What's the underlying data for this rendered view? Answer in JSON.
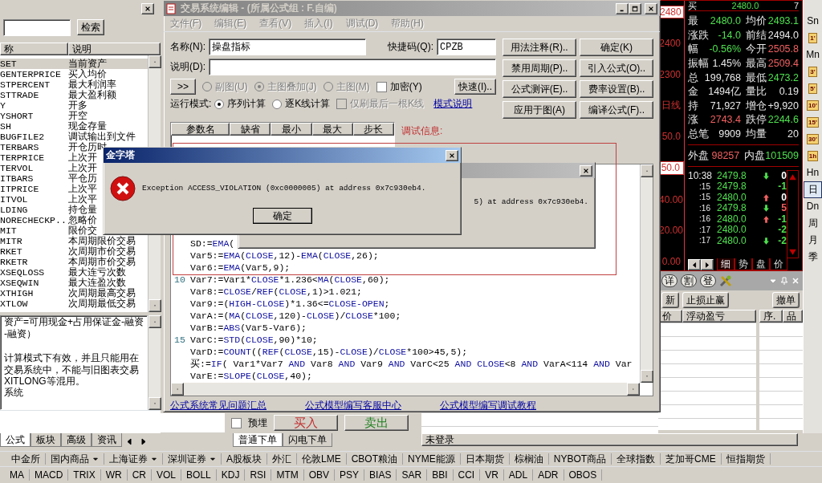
{
  "left_panel": {
    "search_button": "检索",
    "columns": [
      "称",
      "说明"
    ],
    "rows": [
      {
        "name": "SET",
        "desc": "当前资产",
        "selected": true
      },
      {
        "name": "GENTERPRICE",
        "desc": "买入均价",
        "selected": false
      },
      {
        "name": "STPERCENT",
        "desc": "最大利润率",
        "selected": false
      },
      {
        "name": "STTRADE",
        "desc": "最大盈利额",
        "selected": false
      },
      {
        "name": "Y",
        "desc": "开多",
        "selected": false
      },
      {
        "name": "YSHORT",
        "desc": "开空",
        "selected": false
      },
      {
        "name": "SH",
        "desc": "现金存量",
        "selected": false
      },
      {
        "name": "BUGFILE2",
        "desc": "调试输出到文件",
        "selected": false
      },
      {
        "name": "TERBARS",
        "desc": "开仓历时",
        "selected": false
      },
      {
        "name": "TERPRICE",
        "desc": "上次开",
        "selected": false
      },
      {
        "name": "TERVOL",
        "desc": "上次开",
        "selected": false
      },
      {
        "name": "ITBARS",
        "desc": "平仓历",
        "selected": false
      },
      {
        "name": "ITPRICE",
        "desc": "上次平",
        "selected": false
      },
      {
        "name": "ITVOL",
        "desc": "上次平",
        "selected": false
      },
      {
        "name": "LDING",
        "desc": "持仓量",
        "selected": false
      },
      {
        "name": "NORECHECKP...",
        "desc": "忽略价",
        "selected": false
      },
      {
        "name": "MIT",
        "desc": "限价交",
        "selected": false
      },
      {
        "name": "MITR",
        "desc": "本周期限价交易",
        "selected": false
      },
      {
        "name": "RKET",
        "desc": "次周期市价交易",
        "selected": false
      },
      {
        "name": "RKETR",
        "desc": "本周期市价交易",
        "selected": false
      },
      {
        "name": "XSEQLOSS",
        "desc": "最大连亏次数",
        "selected": false
      },
      {
        "name": "XSEQWIN",
        "desc": "最大连盈次数",
        "selected": false
      },
      {
        "name": "XTHIGH",
        "desc": "次周期最高交易",
        "selected": false
      },
      {
        "name": "XTLOW",
        "desc": "次周期最低交易",
        "selected": false
      }
    ],
    "description": [
      [
        "资产=可用现金+占用保证金-融资",
        "-融资）"
      ],
      [
        "计算模式下有效，并且只能用在",
        "交易系统中，不能与旧图表交易",
        "XITLONG等混用。",
        "系统"
      ]
    ]
  },
  "editor": {
    "title": "交易系统编辑 - (所属公式组 : F.自编)",
    "menu": [
      {
        "label": "文件(F)",
        "disabled": true
      },
      {
        "label": "编辑(E)",
        "disabled": true
      },
      {
        "label": "查看(V)",
        "disabled": true
      },
      {
        "label": "插入(I)",
        "disabled": true
      },
      {
        "label": "调试(D)",
        "disabled": true
      },
      {
        "label": "帮助(H)",
        "disabled": true
      }
    ],
    "name_field": {
      "label": "名称(N):",
      "value": "操盘指标"
    },
    "shortcut_field": {
      "label": "快捷码(Q):",
      "value": "CPZB"
    },
    "desc_field": {
      "label": "说明(D):"
    },
    "side_buttons": [
      "用法注释(R)..",
      "确定(K)",
      "禁用周期(P)..",
      "引入公式(O)..",
      "公式测评(E)..",
      "费率设置(B)..",
      "应用于图(A)",
      "编译公式(F).."
    ],
    "expand_button": ">>",
    "chart_modes": [
      {
        "label": "副图(U)",
        "selected": false,
        "disabled": true
      },
      {
        "label": "主图叠加(J)",
        "selected": true,
        "disabled": true
      },
      {
        "label": "主图(M)",
        "selected": false,
        "disabled": true
      }
    ],
    "encrypt": {
      "label": "加密(Y)",
      "checked": false
    },
    "quick_button": "快速(I)..",
    "run_mode": {
      "label": "运行模式:",
      "options": [
        {
          "label": "序列计算",
          "selected": true
        },
        {
          "label": "逐K线计算",
          "selected": false
        }
      ],
      "last_bar": {
        "label": "仅刷最后一根K线",
        "checked": false,
        "disabled": true
      },
      "help_link": "模式说明"
    },
    "param_columns": [
      "参数名",
      "缺省",
      "最小",
      "最大",
      "步长"
    ],
    "debug_label": "调试信息:",
    "code_lines": [
      {
        "tokens": [
          {
            "t": "SD:=",
            "kw": false
          },
          {
            "t": "EMA",
            "kw": true
          },
          {
            "t": "(",
            "kw": false
          }
        ]
      },
      {
        "tokens": [
          {
            "t": "Var5:=",
            "kw": false
          },
          {
            "t": "EMA",
            "kw": true
          },
          {
            "t": "(",
            "kw": false
          },
          {
            "t": "CLOSE",
            "kw": true
          },
          {
            "t": ",12)-",
            "kw": false
          },
          {
            "t": "EMA",
            "kw": true
          },
          {
            "t": "(",
            "kw": false
          },
          {
            "t": "CLOSE",
            "kw": true
          },
          {
            "t": ",26);",
            "kw": false
          }
        ]
      },
      {
        "tokens": [
          {
            "t": "Var6:=",
            "kw": false
          },
          {
            "t": "EMA",
            "kw": true
          },
          {
            "t": "(Var5,9);",
            "kw": false
          }
        ]
      },
      {
        "number": "10",
        "tokens": [
          {
            "t": "Var7:=Var1*",
            "kw": false
          },
          {
            "t": "CLOSE",
            "kw": true
          },
          {
            "t": "*1.236<",
            "kw": false
          },
          {
            "t": "MA",
            "kw": true
          },
          {
            "t": "(",
            "kw": false
          },
          {
            "t": "CLOSE",
            "kw": true
          },
          {
            "t": ",60);",
            "kw": false
          }
        ]
      },
      {
        "tokens": [
          {
            "t": "Var8:=",
            "kw": false
          },
          {
            "t": "CLOSE",
            "kw": true
          },
          {
            "t": "/",
            "kw": false
          },
          {
            "t": "REF",
            "kw": true
          },
          {
            "t": "(",
            "kw": false
          },
          {
            "t": "CLOSE",
            "kw": true
          },
          {
            "t": ",1)>1.021;",
            "kw": false
          }
        ]
      },
      {
        "tokens": [
          {
            "t": "Var9:=(",
            "kw": false
          },
          {
            "t": "HIGH-CLOSE",
            "kw": true
          },
          {
            "t": ")*1.36<=",
            "kw": false
          },
          {
            "t": "CLOSE-OPEN",
            "kw": true
          },
          {
            "t": ";",
            "kw": false
          }
        ]
      },
      {
        "tokens": [
          {
            "t": "VarA:=(",
            "kw": false
          },
          {
            "t": "MA",
            "kw": true
          },
          {
            "t": "(",
            "kw": false
          },
          {
            "t": "CLOSE",
            "kw": true
          },
          {
            "t": ",120)-",
            "kw": false
          },
          {
            "t": "CLOSE",
            "kw": true
          },
          {
            "t": ")/",
            "kw": false
          },
          {
            "t": "CLOSE",
            "kw": true
          },
          {
            "t": "*100;",
            "kw": false
          }
        ]
      },
      {
        "tokens": [
          {
            "t": "VarB:=",
            "kw": false
          },
          {
            "t": "ABS",
            "kw": true
          },
          {
            "t": "(Var5-Var6);",
            "kw": false
          }
        ]
      },
      {
        "number": "15",
        "tokens": [
          {
            "t": "VarC:=",
            "kw": false
          },
          {
            "t": "STD",
            "kw": true
          },
          {
            "t": "(",
            "kw": false
          },
          {
            "t": "CLOSE",
            "kw": true
          },
          {
            "t": ",90)*10;",
            "kw": false
          }
        ]
      },
      {
        "tokens": [
          {
            "t": "VarD:=",
            "kw": false
          },
          {
            "t": "COUNT",
            "kw": true
          },
          {
            "t": "((",
            "kw": false
          },
          {
            "t": "REF",
            "kw": true
          },
          {
            "t": "(",
            "kw": false
          },
          {
            "t": "CLOSE",
            "kw": true
          },
          {
            "t": ",15)-",
            "kw": false
          },
          {
            "t": "CLOSE",
            "kw": true
          },
          {
            "t": ")/",
            "kw": false
          },
          {
            "t": "CLOSE",
            "kw": true
          },
          {
            "t": "*100>45,5);",
            "kw": false
          }
        ]
      },
      {
        "tokens": [
          {
            "t": "买:=",
            "kw": false
          },
          {
            "t": "IF",
            "kw": true
          },
          {
            "t": "( Var1*Var7 ",
            "kw": false
          },
          {
            "t": "AND",
            "kw": true
          },
          {
            "t": " Var8 ",
            "kw": false
          },
          {
            "t": "AND",
            "kw": true
          },
          {
            "t": " Var9 ",
            "kw": false
          },
          {
            "t": "AND",
            "kw": true
          },
          {
            "t": " VarC<25 ",
            "kw": false
          },
          {
            "t": "AND",
            "kw": true
          },
          {
            "t": " CLOSE",
            "kw": true
          },
          {
            "t": "<8 ",
            "kw": false
          },
          {
            "t": "AND",
            "kw": true
          },
          {
            "t": " VarA<114 ",
            "kw": false
          },
          {
            "t": "AND",
            "kw": true
          },
          {
            "t": " Var",
            "kw": false
          }
        ]
      },
      {
        "tokens": [
          {
            "t": "VarE:=",
            "kw": false
          },
          {
            "t": "SLOPE",
            "kw": true
          },
          {
            "t": "(",
            "kw": false
          },
          {
            "t": "CLOSE",
            "kw": true
          },
          {
            "t": ",40);",
            "kw": false
          }
        ]
      }
    ],
    "links": [
      "公式系统常见问题汇总",
      "公式模型编写客服中心",
      "公式模型编写调试教程"
    ]
  },
  "dialogs": [
    {
      "active": false,
      "message": "5) at address 0x7c930eb4."
    },
    {
      "active": true,
      "title": "金字塔",
      "message": "Exception ACCESS_VIOLATION (0xc0000005) at address 0x7c930eb4.",
      "button": "确定"
    }
  ],
  "order_strip": {
    "preset": {
      "label": "预埋",
      "checked": false
    },
    "buy": "买入",
    "sell": "卖出"
  },
  "quote_panel": {
    "axis_labels": [
      {
        "text": "2480",
        "boxed": true
      },
      {
        "text": "2400",
        "boxed": false
      },
      {
        "text": "2300",
        "boxed": false
      },
      {
        "text": "日线",
        "boxed": false
      },
      {
        "text": "50.0",
        "boxed": false
      },
      {
        "text": "50.0",
        "boxed": true
      },
      {
        "text": "40.00",
        "boxed": false
      },
      {
        "text": "20.00",
        "boxed": false
      },
      {
        "text": "0.00",
        "boxed": false
      }
    ],
    "top_row": {
      "label": "买",
      "value": "2480.0",
      "volume": "7"
    },
    "quotes": [
      {
        "label": "最",
        "value": "2480.0",
        "color": "#4ee04e"
      },
      {
        "label": "均价",
        "value": "2493.1",
        "color": "#4ee04e"
      },
      {
        "label": "涨跌",
        "value": "-14.0",
        "color": "#4ee04e"
      },
      {
        "label": "前结",
        "value": "2494.0",
        "color": "#e8e8e8"
      },
      {
        "label": "幅",
        "value": "-0.56%",
        "color": "#4ee04e"
      },
      {
        "label": "今开",
        "value": "2505.8",
        "color": "#f06060"
      },
      {
        "label": "振幅",
        "value": "1.45%",
        "color": "#e8e8e8"
      },
      {
        "label": "最高",
        "value": "2509.4",
        "color": "#f06060"
      },
      {
        "label": "总",
        "value": "199,768",
        "color": "#e8e8e8"
      },
      {
        "label": "最低",
        "value": "2473.2",
        "color": "#4ee04e"
      },
      {
        "label": "金",
        "value": "1494亿",
        "color": "#e8e8e8"
      },
      {
        "label": "量比",
        "value": "0.19",
        "color": "#e8e8e8"
      },
      {
        "label": "持",
        "value": "71,927",
        "color": "#e8e8e8"
      },
      {
        "label": "增仓",
        "value": "+9,920",
        "color": "#e8e8e8"
      },
      {
        "label": "涨",
        "value": "2743.4",
        "color": "#f06060"
      },
      {
        "label": "跌停",
        "value": "2244.6",
        "color": "#4ee04e"
      },
      {
        "label": "总笔",
        "value": "9909",
        "color": "#e8e8e8"
      },
      {
        "label": "均量",
        "value": "20",
        "color": "#e8e8e8"
      }
    ],
    "sides": [
      {
        "label": "外盘",
        "value": "98257",
        "color": "#f06060"
      },
      {
        "label": "内盘",
        "value": "101509",
        "color": "#4ee04e"
      }
    ],
    "ticks": [
      {
        "time": "10:38",
        "price": "2479.8",
        "arrow": {
          "kind": "down",
          "color": "#4ee04e"
        },
        "volume": {
          "text": "0",
          "color": "#ffffff"
        }
      },
      {
        "time": ":15",
        "price": "2479.8",
        "volume": {
          "text": "-1",
          "color": "#4ee04e"
        }
      },
      {
        "time": ":15",
        "price": "2480.0",
        "arrow": {
          "kind": "up",
          "color": "#f06060"
        },
        "volume": {
          "text": "0",
          "color": "#ffffff"
        }
      },
      {
        "time": ":16",
        "price": "2479.8",
        "arrow": {
          "kind": "down",
          "color": "#4ee04e"
        },
        "volume": {
          "text": "5",
          "color": "#f06060"
        }
      },
      {
        "time": ":16",
        "price": "2480.0",
        "arrow": {
          "kind": "up",
          "color": "#f06060"
        },
        "volume": {
          "text": "-1",
          "color": "#4ee04e"
        }
      },
      {
        "time": ":17",
        "price": "2480.0",
        "volume": {
          "text": "-2",
          "color": "#4ee04e"
        }
      },
      {
        "time": ":17",
        "price": "2480.0",
        "arrow": {
          "kind": "down",
          "color": "#4ee04e"
        },
        "volume": {
          "text": "-2",
          "color": "#4ee04e"
        }
      }
    ],
    "tabs": [
      {
        "label": "细",
        "selected": true
      },
      {
        "label": "势",
        "selected": false
      },
      {
        "label": "盘",
        "selected": false
      },
      {
        "label": "价",
        "selected": false
      }
    ]
  },
  "period_strip": [
    {
      "label": "Sn",
      "kind": "text",
      "selected": false
    },
    {
      "label": "1'",
      "kind": "icon",
      "selected": false
    },
    {
      "label": "Mn",
      "kind": "text",
      "selected": false
    },
    {
      "label": "3'",
      "kind": "icon",
      "selected": false
    },
    {
      "label": "5'",
      "kind": "icon",
      "selected": false
    },
    {
      "label": "10'",
      "kind": "icon",
      "selected": false
    },
    {
      "label": "15'",
      "kind": "icon",
      "selected": false
    },
    {
      "label": "30'",
      "kind": "icon",
      "selected": false
    },
    {
      "label": "1h",
      "kind": "icon",
      "selected": false
    },
    {
      "label": "Hn",
      "kind": "text",
      "selected": false
    },
    {
      "label": "日",
      "kind": "text",
      "selected": true
    },
    {
      "label": "Dn",
      "kind": "text",
      "selected": false
    },
    {
      "label": "周",
      "kind": "text",
      "selected": false
    },
    {
      "label": "月",
      "kind": "text",
      "selected": false
    },
    {
      "label": "季",
      "kind": "text",
      "selected": false
    }
  ],
  "trade_panel": {
    "tool_buttons": [
      "详",
      "割",
      "登"
    ],
    "buttons": [
      "新",
      "止损止赢"
    ],
    "cancel_button": "撤单",
    "columns": [
      "价",
      "浮动盈亏"
    ],
    "side_columns": [
      "序.",
      "品"
    ]
  },
  "bottom_tabs": {
    "left": [
      {
        "label": "公式",
        "selected": true
      },
      {
        "label": "板块",
        "selected": false
      },
      {
        "label": "高级",
        "selected": false
      },
      {
        "label": "资讯",
        "selected": false
      }
    ],
    "order": [
      {
        "label": "普通下单",
        "selected": true
      },
      {
        "label": "闪电下单",
        "selected": false
      }
    ],
    "status": "未登录"
  },
  "market_bar": [
    {
      "label": "中金所",
      "menu": false
    },
    {
      "label": "国内商品",
      "menu": true
    },
    {
      "label": "上海证券",
      "menu": true
    },
    {
      "label": "深圳证券",
      "menu": true
    },
    {
      "label": "A股板块",
      "menu": false
    },
    {
      "label": "外汇",
      "menu": false
    },
    {
      "label": "伦敦LME",
      "menu": false
    },
    {
      "label": "CBOT粮油",
      "menu": false
    },
    {
      "label": "NYME能源",
      "menu": false
    },
    {
      "label": "日本期货",
      "menu": false
    },
    {
      "label": "棕榈油",
      "menu": false
    },
    {
      "label": "NYBOT商品",
      "menu": false
    },
    {
      "label": "全球指数",
      "menu": false
    },
    {
      "label": "芝加哥CME",
      "menu": false
    },
    {
      "label": "恒指期货",
      "menu": false
    }
  ],
  "indicator_bar": [
    "MA",
    "MACD",
    "TRIX",
    "WR",
    "CR",
    "VOL",
    "BOLL",
    "KDJ",
    "RSI",
    "MTM",
    "OBV",
    "PSY",
    "BIAS",
    "SAR",
    "BBI",
    "CCI",
    "VR",
    "ADL",
    "ADR",
    "OBOS"
  ]
}
